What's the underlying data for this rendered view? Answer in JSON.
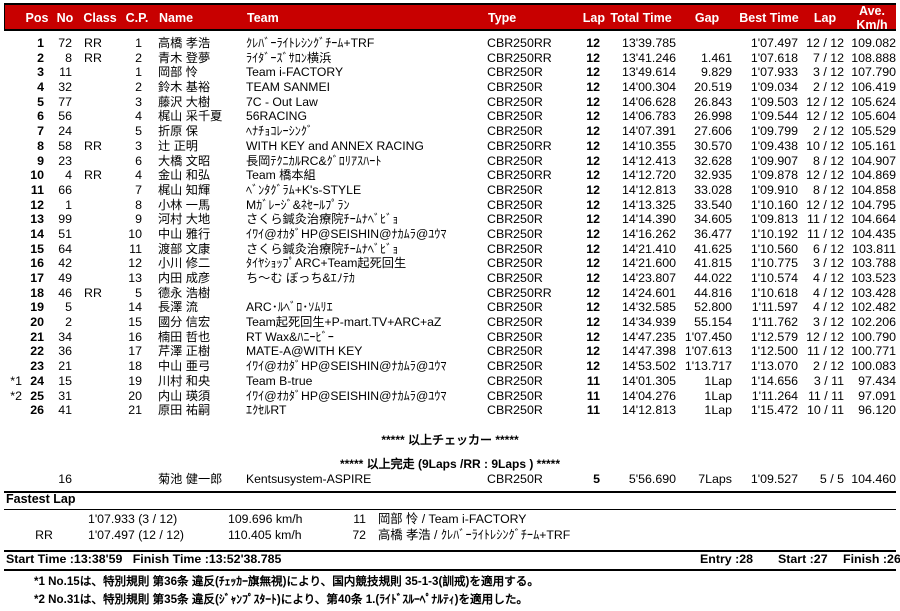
{
  "header": {
    "columns": [
      {
        "key": "pos",
        "label": "Pos"
      },
      {
        "key": "no",
        "label": "No"
      },
      {
        "key": "class",
        "label": "Class"
      },
      {
        "key": "cp",
        "label": "C.P."
      },
      {
        "key": "name",
        "label": "Name"
      },
      {
        "key": "team",
        "label": "Team"
      },
      {
        "key": "type",
        "label": "Type"
      },
      {
        "key": "lap",
        "label": "Lap"
      },
      {
        "key": "total",
        "label": "Total Time"
      },
      {
        "key": "gap",
        "label": "Gap"
      },
      {
        "key": "best",
        "label": "Best Time"
      },
      {
        "key": "lap2",
        "label": "Lap"
      },
      {
        "key": "ave",
        "label": "Ave.\nKm/h"
      }
    ],
    "ave_line1": "Ave.",
    "ave_line2": "Km/h",
    "bg_color": "#c80000",
    "text_color": "#ffffff"
  },
  "results": [
    {
      "note": "",
      "pos": "1",
      "no": "72",
      "class": "RR",
      "cp": "1",
      "name": "高橋 孝浩",
      "team": "ｸﾚﾊﾞｰﾗｲﾄﾚｼﾝｸﾞﾁｰﾑ+TRF",
      "type": "CBR250RR",
      "lap": "12",
      "total": "13'39.785",
      "gap": "",
      "best": "1'07.497",
      "lap2": "12 / 12",
      "ave": "109.082"
    },
    {
      "note": "",
      "pos": "2",
      "no": "8",
      "class": "RR",
      "cp": "2",
      "name": "青木 登夢",
      "team": "ﾗｲﾀﾞｰｽﾞｻﾛﾝ横浜",
      "type": "CBR250RR",
      "lap": "12",
      "total": "13'41.246",
      "gap": "1.461",
      "best": "1'07.618",
      "lap2": "7 / 12",
      "ave": "108.888"
    },
    {
      "note": "",
      "pos": "3",
      "no": "11",
      "class": "",
      "cp": "1",
      "name": "岡部 怜",
      "team": "Team  i-FACTORY",
      "type": "CBR250R",
      "lap": "12",
      "total": "13'49.614",
      "gap": "9.829",
      "best": "1'07.933",
      "lap2": "3 / 12",
      "ave": "107.790"
    },
    {
      "note": "",
      "pos": "4",
      "no": "32",
      "class": "",
      "cp": "2",
      "name": "鈴木 基裕",
      "team": "TEAM  SANMEI",
      "type": "CBR250R",
      "lap": "12",
      "total": "14'00.304",
      "gap": "20.519",
      "best": "1'09.034",
      "lap2": "2 / 12",
      "ave": "106.419"
    },
    {
      "note": "",
      "pos": "5",
      "no": "77",
      "class": "",
      "cp": "3",
      "name": "藤沢 大樹",
      "team": "7C - Out Law",
      "type": "CBR250R",
      "lap": "12",
      "total": "14'06.628",
      "gap": "26.843",
      "best": "1'09.503",
      "lap2": "12 / 12",
      "ave": "105.624"
    },
    {
      "note": "",
      "pos": "6",
      "no": "56",
      "class": "",
      "cp": "4",
      "name": "梶山 采千夏",
      "team": "56RACING",
      "type": "CBR250R",
      "lap": "12",
      "total": "14'06.783",
      "gap": "26.998",
      "best": "1'09.544",
      "lap2": "12 / 12",
      "ave": "105.604"
    },
    {
      "note": "",
      "pos": "7",
      "no": "24",
      "class": "",
      "cp": "5",
      "name": "折原 保",
      "team": "ﾍﾅﾁｮｺﾚｰｼﾝｸﾞ",
      "type": "CBR250R",
      "lap": "12",
      "total": "14'07.391",
      "gap": "27.606",
      "best": "1'09.799",
      "lap2": "2 / 12",
      "ave": "105.529"
    },
    {
      "note": "",
      "pos": "8",
      "no": "58",
      "class": "RR",
      "cp": "3",
      "name": "辻  正明",
      "team": "WITH KEY and ANNEX RACING",
      "type": "CBR250RR",
      "lap": "12",
      "total": "14'10.355",
      "gap": "30.570",
      "best": "1'09.438",
      "lap2": "10 / 12",
      "ave": "105.161"
    },
    {
      "note": "",
      "pos": "9",
      "no": "23",
      "class": "",
      "cp": "6",
      "name": "大橋 文昭",
      "team": "長岡ﾃｸﾆｶﾙRC&ｸﾞﾛﾘｱｽﾊｰﾄ",
      "type": "CBR250R",
      "lap": "12",
      "total": "14'12.413",
      "gap": "32.628",
      "best": "1'09.907",
      "lap2": "8 / 12",
      "ave": "104.907"
    },
    {
      "note": "",
      "pos": "10",
      "no": "4",
      "class": "RR",
      "cp": "4",
      "name": "金山 和弘",
      "team": "Team 橋本組",
      "type": "CBR250RR",
      "lap": "12",
      "total": "14'12.720",
      "gap": "32.935",
      "best": "1'09.878",
      "lap2": "12 / 12",
      "ave": "104.869"
    },
    {
      "note": "",
      "pos": "11",
      "no": "66",
      "class": "",
      "cp": "7",
      "name": "梶山 知輝",
      "team": "ﾍﾞﾝﾀｸﾞﾗﾑ+K's-STYLE",
      "type": "CBR250R",
      "lap": "12",
      "total": "14'12.813",
      "gap": "33.028",
      "best": "1'09.910",
      "lap2": "8 / 12",
      "ave": "104.858"
    },
    {
      "note": "",
      "pos": "12",
      "no": "1",
      "class": "",
      "cp": "8",
      "name": "小林 一馬",
      "team": "Mｶﾞﾚｰｼﾞ&ﾈｾｰﾙﾌﾟﾗﾝ",
      "type": "CBR250R",
      "lap": "12",
      "total": "14'13.325",
      "gap": "33.540",
      "best": "1'10.160",
      "lap2": "12 / 12",
      "ave": "104.795"
    },
    {
      "note": "",
      "pos": "13",
      "no": "99",
      "class": "",
      "cp": "9",
      "name": "河村 大地",
      "team": "さくら鍼灸治療院ﾁｰﾑﾅﾍﾞﾋﾞｮ",
      "type": "CBR250R",
      "lap": "12",
      "total": "14'14.390",
      "gap": "34.605",
      "best": "1'09.813",
      "lap2": "11 / 12",
      "ave": "104.664"
    },
    {
      "note": "",
      "pos": "14",
      "no": "51",
      "class": "",
      "cp": "10",
      "name": "中山 雅行",
      "team": "ｲﾜｲ@ｵｶﾀﾞHP@SEISHIN@ﾅｶﾑﾗ@ﾕｳﾏ",
      "type": "CBR250R",
      "lap": "12",
      "total": "14'16.262",
      "gap": "36.477",
      "best": "1'10.192",
      "lap2": "11 / 12",
      "ave": "104.435"
    },
    {
      "note": "",
      "pos": "15",
      "no": "64",
      "class": "",
      "cp": "11",
      "name": "渡部 文康",
      "team": "さくら鍼灸治療院ﾁｰﾑﾅﾍﾞﾋﾞｮ",
      "type": "CBR250R",
      "lap": "12",
      "total": "14'21.410",
      "gap": "41.625",
      "best": "1'10.560",
      "lap2": "6 / 12",
      "ave": "103.811"
    },
    {
      "note": "",
      "pos": "16",
      "no": "42",
      "class": "",
      "cp": "12",
      "name": "小川 修二",
      "team": "ﾀｲﾔｼｮｯﾌﾟARC+Team起死回生",
      "type": "CBR250R",
      "lap": "12",
      "total": "14'21.600",
      "gap": "41.815",
      "best": "1'10.775",
      "lap2": "3 / 12",
      "ave": "103.788"
    },
    {
      "note": "",
      "pos": "17",
      "no": "49",
      "class": "",
      "cp": "13",
      "name": "内田 成彦",
      "team": "ち～む ぼっち&ｴﾉﾃｶ",
      "type": "CBR250R",
      "lap": "12",
      "total": "14'23.807",
      "gap": "44.022",
      "best": "1'10.574",
      "lap2": "4 / 12",
      "ave": "103.523"
    },
    {
      "note": "",
      "pos": "18",
      "no": "46",
      "class": "RR",
      "cp": "5",
      "name": "德永 浩樹",
      "team": "",
      "type": "CBR250RR",
      "lap": "12",
      "total": "14'24.601",
      "gap": "44.816",
      "best": "1'10.618",
      "lap2": "4 / 12",
      "ave": "103.428"
    },
    {
      "note": "",
      "pos": "19",
      "no": "5",
      "class": "",
      "cp": "14",
      "name": "長澤 流",
      "team": "ARC･ﾙﾍﾞﾛ･ｿﾑﾘｴ",
      "type": "CBR250R",
      "lap": "12",
      "total": "14'32.585",
      "gap": "52.800",
      "best": "1'11.597",
      "lap2": "4 / 12",
      "ave": "102.482"
    },
    {
      "note": "",
      "pos": "20",
      "no": "2",
      "class": "",
      "cp": "15",
      "name": "國分 信宏",
      "team": "Team起死回生+P-mart.TV+ARC+aZ",
      "type": "CBR250R",
      "lap": "12",
      "total": "14'34.939",
      "gap": "55.154",
      "best": "1'11.762",
      "lap2": "3 / 12",
      "ave": "102.206"
    },
    {
      "note": "",
      "pos": "21",
      "no": "34",
      "class": "",
      "cp": "16",
      "name": "楠田 哲也",
      "team": "RT Wax&ﾊﾆｰﾋﾞｰ",
      "type": "CBR250R",
      "lap": "12",
      "total": "14'47.235",
      "gap": "1'07.450",
      "best": "1'12.579",
      "lap2": "12 / 12",
      "ave": "100.790"
    },
    {
      "note": "",
      "pos": "22",
      "no": "36",
      "class": "",
      "cp": "17",
      "name": "芹澤 正樹",
      "team": "MATE-A@WITH KEY",
      "type": "CBR250R",
      "lap": "12",
      "total": "14'47.398",
      "gap": "1'07.613",
      "best": "1'12.500",
      "lap2": "11 / 12",
      "ave": "100.771"
    },
    {
      "note": "",
      "pos": "23",
      "no": "21",
      "class": "",
      "cp": "18",
      "name": "中山 亜弓",
      "team": "ｲﾜｲ@ｵｶﾀﾞHP@SEISHIN@ﾅｶﾑﾗ@ﾕｳﾏ",
      "type": "CBR250R",
      "lap": "12",
      "total": "14'53.502",
      "gap": "1'13.717",
      "best": "1'13.070",
      "lap2": "2 / 12",
      "ave": "100.083"
    },
    {
      "note": "*1",
      "pos": "24",
      "no": "15",
      "class": "",
      "cp": "19",
      "name": "川村 和央",
      "team": "Team B-true",
      "type": "CBR250R",
      "lap": "11",
      "total": "14'01.305",
      "gap": "1Lap",
      "best": "1'14.656",
      "lap2": "3 / 11",
      "ave": "97.434"
    },
    {
      "note": "*2",
      "pos": "25",
      "no": "31",
      "class": "",
      "cp": "20",
      "name": "内山 瑛須",
      "team": "ｲﾜｲ@ｵｶﾀﾞHP@SEISHIN@ﾅｶﾑﾗ@ﾕｳﾏ",
      "type": "CBR250R",
      "lap": "11",
      "total": "14'04.276",
      "gap": "1Lap",
      "best": "1'11.264",
      "lap2": "11 / 11",
      "ave": "97.091"
    },
    {
      "note": "",
      "pos": "26",
      "no": "41",
      "class": "",
      "cp": "21",
      "name": "原田 祐嗣",
      "team": "ｴｸｾﾙRT",
      "type": "CBR250R",
      "lap": "11",
      "total": "14'12.813",
      "gap": "1Lap",
      "best": "1'15.472",
      "lap2": "10 / 11",
      "ave": "96.120"
    }
  ],
  "checker_line": "***** 以上チェッカー *****",
  "finish_line": "***** 以上完走 (9Laps /RR : 9Laps ) *****",
  "dnf": [
    {
      "note": "",
      "pos": "",
      "no": "16",
      "class": "",
      "cp": "",
      "name": "菊池 健一郎",
      "team": "Kentsusystem-ASPIRE",
      "type": "CBR250R",
      "lap": "5",
      "total": "5'56.690",
      "gap": "7Laps",
      "best": "1'09.527",
      "lap2": "5 / 5",
      "ave": "104.460"
    }
  ],
  "fastest_lap": {
    "title": "Fastest Lap",
    "rows": [
      {
        "class": "",
        "time": "1'07.933 (3 / 12)",
        "speed": "109.696 km/h",
        "no": "11",
        "who": "岡部 怜 / Team  i-FACTORY"
      },
      {
        "class": "RR",
        "time": "1'07.497 (12 / 12)",
        "speed": "110.405 km/h",
        "no": "72",
        "who": "高橋 孝浩 / ｸﾚﾊﾞｰﾗｲﾄﾚｼﾝｸﾞﾁｰﾑ+TRF"
      }
    ]
  },
  "summary": {
    "start_time": "Start Time :13:38'59",
    "finish_time": "Finish Time :13:52'38.785",
    "entry": "Entry :28",
    "start": "Start :27",
    "finish": "Finish :26"
  },
  "footnotes": [
    "*1 No.15は、特別規則  第36条  違反(ﾁｪｯｶｰ旗無視)により、国内競技規則  35-1-3(訓戒)を適用する。",
    "*2 No.31は、特別規則  第35条  違反(ｼﾞｬﾝﾌﾟｽﾀｰﾄ)により、第40条 1.(ﾗｲﾄﾞｽﾙｰﾍﾟﾅﾙﾃｨ)を適用した。"
  ]
}
